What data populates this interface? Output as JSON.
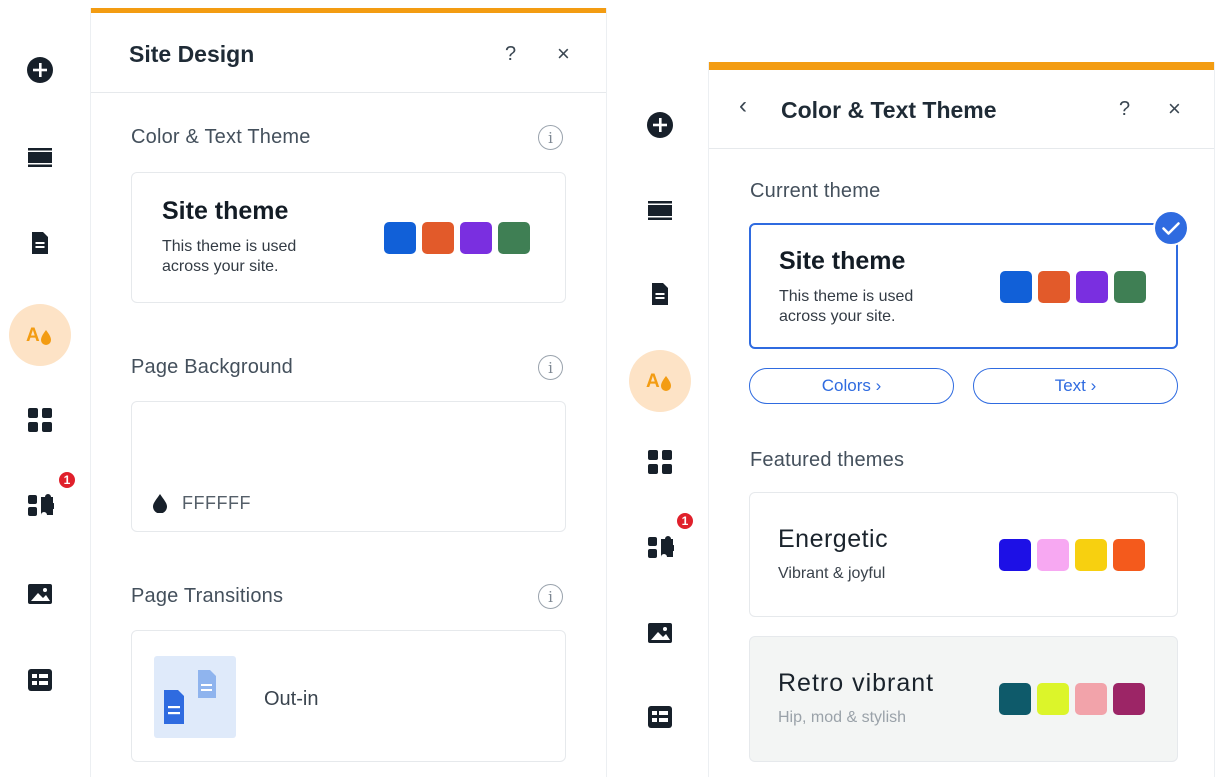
{
  "left_panel": {
    "title": "Site Design",
    "help": "?",
    "close": "×",
    "sections": {
      "theme": {
        "label": "Color & Text Theme",
        "card_title": "Site theme",
        "card_sub_1": "This theme is used",
        "card_sub_2": "across your site."
      },
      "background": {
        "label": "Page Background",
        "color_value": "FFFFFF"
      },
      "transitions": {
        "label": "Page Transitions",
        "value": "Out-in"
      }
    }
  },
  "right_panel": {
    "title": "Color & Text Theme",
    "help": "?",
    "close": "×",
    "back": "‹",
    "current_label": "Current theme",
    "current_card": {
      "title": "Site theme",
      "sub_1": "This theme is used",
      "sub_2": "across your site."
    },
    "colors_button": "Colors ›",
    "text_button": "Text ›",
    "featured_label": "Featured themes",
    "featured": [
      {
        "name": "Energetic",
        "desc": "Vibrant & joyful"
      },
      {
        "name": "Retro vibrant",
        "desc": "Hip, mod & stylish"
      }
    ]
  },
  "rail": {
    "badge_count": "1"
  },
  "colors": {
    "accent": "#f39c12",
    "primary": "#2f6be0",
    "site_theme": [
      "#1160d8",
      "#e25a2a",
      "#7a2fe0",
      "#3f7f54"
    ],
    "energetic": [
      "#1d10e6",
      "#f7a8f2",
      "#f7d010",
      "#f45a1c"
    ],
    "retro_vibrant": [
      "#0e5a6a",
      "#dcf52a",
      "#f2a3aa",
      "#9c2566"
    ]
  }
}
